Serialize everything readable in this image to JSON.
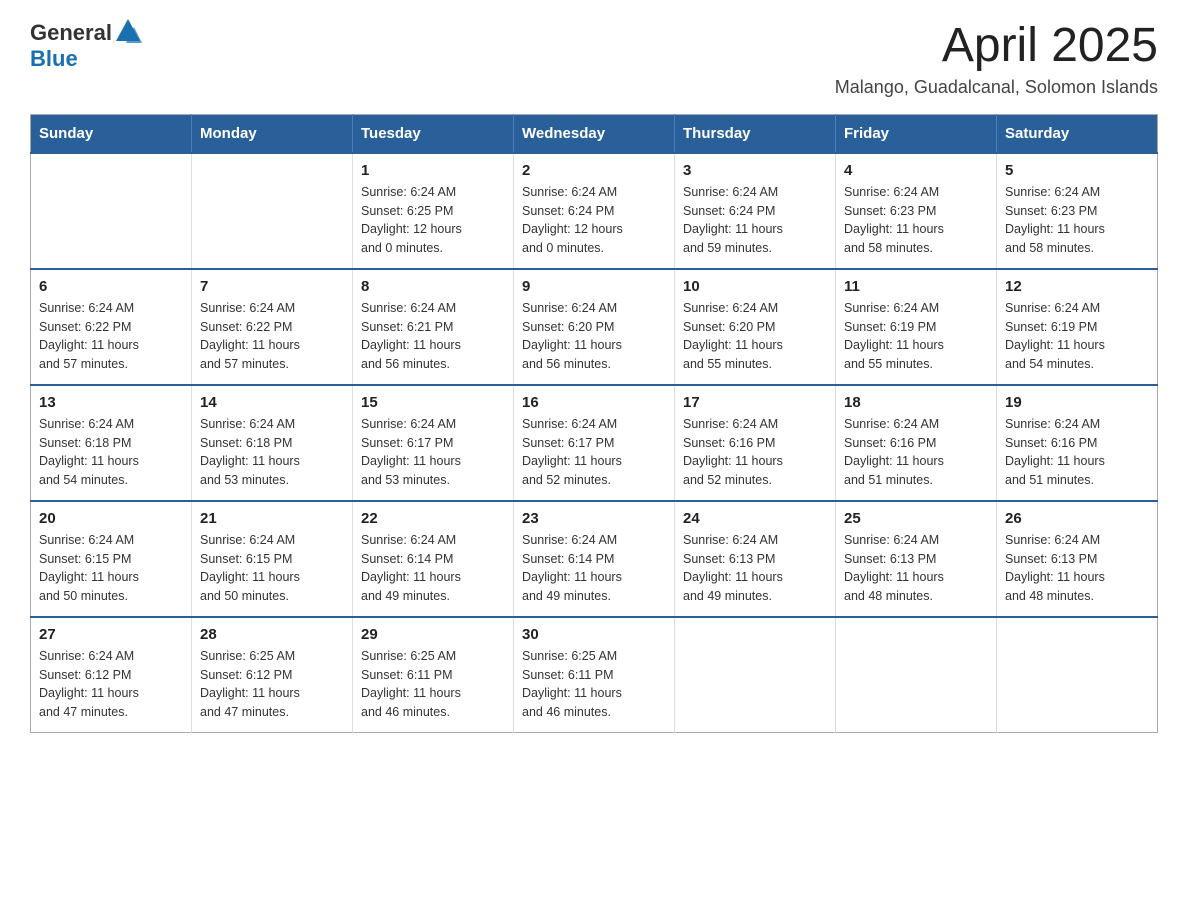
{
  "header": {
    "logo_general": "General",
    "logo_blue": "Blue",
    "month_title": "April 2025",
    "location": "Malango, Guadalcanal, Solomon Islands"
  },
  "weekdays": [
    "Sunday",
    "Monday",
    "Tuesday",
    "Wednesday",
    "Thursday",
    "Friday",
    "Saturday"
  ],
  "weeks": [
    [
      {
        "day": "",
        "info": ""
      },
      {
        "day": "",
        "info": ""
      },
      {
        "day": "1",
        "info": "Sunrise: 6:24 AM\nSunset: 6:25 PM\nDaylight: 12 hours\nand 0 minutes."
      },
      {
        "day": "2",
        "info": "Sunrise: 6:24 AM\nSunset: 6:24 PM\nDaylight: 12 hours\nand 0 minutes."
      },
      {
        "day": "3",
        "info": "Sunrise: 6:24 AM\nSunset: 6:24 PM\nDaylight: 11 hours\nand 59 minutes."
      },
      {
        "day": "4",
        "info": "Sunrise: 6:24 AM\nSunset: 6:23 PM\nDaylight: 11 hours\nand 58 minutes."
      },
      {
        "day": "5",
        "info": "Sunrise: 6:24 AM\nSunset: 6:23 PM\nDaylight: 11 hours\nand 58 minutes."
      }
    ],
    [
      {
        "day": "6",
        "info": "Sunrise: 6:24 AM\nSunset: 6:22 PM\nDaylight: 11 hours\nand 57 minutes."
      },
      {
        "day": "7",
        "info": "Sunrise: 6:24 AM\nSunset: 6:22 PM\nDaylight: 11 hours\nand 57 minutes."
      },
      {
        "day": "8",
        "info": "Sunrise: 6:24 AM\nSunset: 6:21 PM\nDaylight: 11 hours\nand 56 minutes."
      },
      {
        "day": "9",
        "info": "Sunrise: 6:24 AM\nSunset: 6:20 PM\nDaylight: 11 hours\nand 56 minutes."
      },
      {
        "day": "10",
        "info": "Sunrise: 6:24 AM\nSunset: 6:20 PM\nDaylight: 11 hours\nand 55 minutes."
      },
      {
        "day": "11",
        "info": "Sunrise: 6:24 AM\nSunset: 6:19 PM\nDaylight: 11 hours\nand 55 minutes."
      },
      {
        "day": "12",
        "info": "Sunrise: 6:24 AM\nSunset: 6:19 PM\nDaylight: 11 hours\nand 54 minutes."
      }
    ],
    [
      {
        "day": "13",
        "info": "Sunrise: 6:24 AM\nSunset: 6:18 PM\nDaylight: 11 hours\nand 54 minutes."
      },
      {
        "day": "14",
        "info": "Sunrise: 6:24 AM\nSunset: 6:18 PM\nDaylight: 11 hours\nand 53 minutes."
      },
      {
        "day": "15",
        "info": "Sunrise: 6:24 AM\nSunset: 6:17 PM\nDaylight: 11 hours\nand 53 minutes."
      },
      {
        "day": "16",
        "info": "Sunrise: 6:24 AM\nSunset: 6:17 PM\nDaylight: 11 hours\nand 52 minutes."
      },
      {
        "day": "17",
        "info": "Sunrise: 6:24 AM\nSunset: 6:16 PM\nDaylight: 11 hours\nand 52 minutes."
      },
      {
        "day": "18",
        "info": "Sunrise: 6:24 AM\nSunset: 6:16 PM\nDaylight: 11 hours\nand 51 minutes."
      },
      {
        "day": "19",
        "info": "Sunrise: 6:24 AM\nSunset: 6:16 PM\nDaylight: 11 hours\nand 51 minutes."
      }
    ],
    [
      {
        "day": "20",
        "info": "Sunrise: 6:24 AM\nSunset: 6:15 PM\nDaylight: 11 hours\nand 50 minutes."
      },
      {
        "day": "21",
        "info": "Sunrise: 6:24 AM\nSunset: 6:15 PM\nDaylight: 11 hours\nand 50 minutes."
      },
      {
        "day": "22",
        "info": "Sunrise: 6:24 AM\nSunset: 6:14 PM\nDaylight: 11 hours\nand 49 minutes."
      },
      {
        "day": "23",
        "info": "Sunrise: 6:24 AM\nSunset: 6:14 PM\nDaylight: 11 hours\nand 49 minutes."
      },
      {
        "day": "24",
        "info": "Sunrise: 6:24 AM\nSunset: 6:13 PM\nDaylight: 11 hours\nand 49 minutes."
      },
      {
        "day": "25",
        "info": "Sunrise: 6:24 AM\nSunset: 6:13 PM\nDaylight: 11 hours\nand 48 minutes."
      },
      {
        "day": "26",
        "info": "Sunrise: 6:24 AM\nSunset: 6:13 PM\nDaylight: 11 hours\nand 48 minutes."
      }
    ],
    [
      {
        "day": "27",
        "info": "Sunrise: 6:24 AM\nSunset: 6:12 PM\nDaylight: 11 hours\nand 47 minutes."
      },
      {
        "day": "28",
        "info": "Sunrise: 6:25 AM\nSunset: 6:12 PM\nDaylight: 11 hours\nand 47 minutes."
      },
      {
        "day": "29",
        "info": "Sunrise: 6:25 AM\nSunset: 6:11 PM\nDaylight: 11 hours\nand 46 minutes."
      },
      {
        "day": "30",
        "info": "Sunrise: 6:25 AM\nSunset: 6:11 PM\nDaylight: 11 hours\nand 46 minutes."
      },
      {
        "day": "",
        "info": ""
      },
      {
        "day": "",
        "info": ""
      },
      {
        "day": "",
        "info": ""
      }
    ]
  ]
}
